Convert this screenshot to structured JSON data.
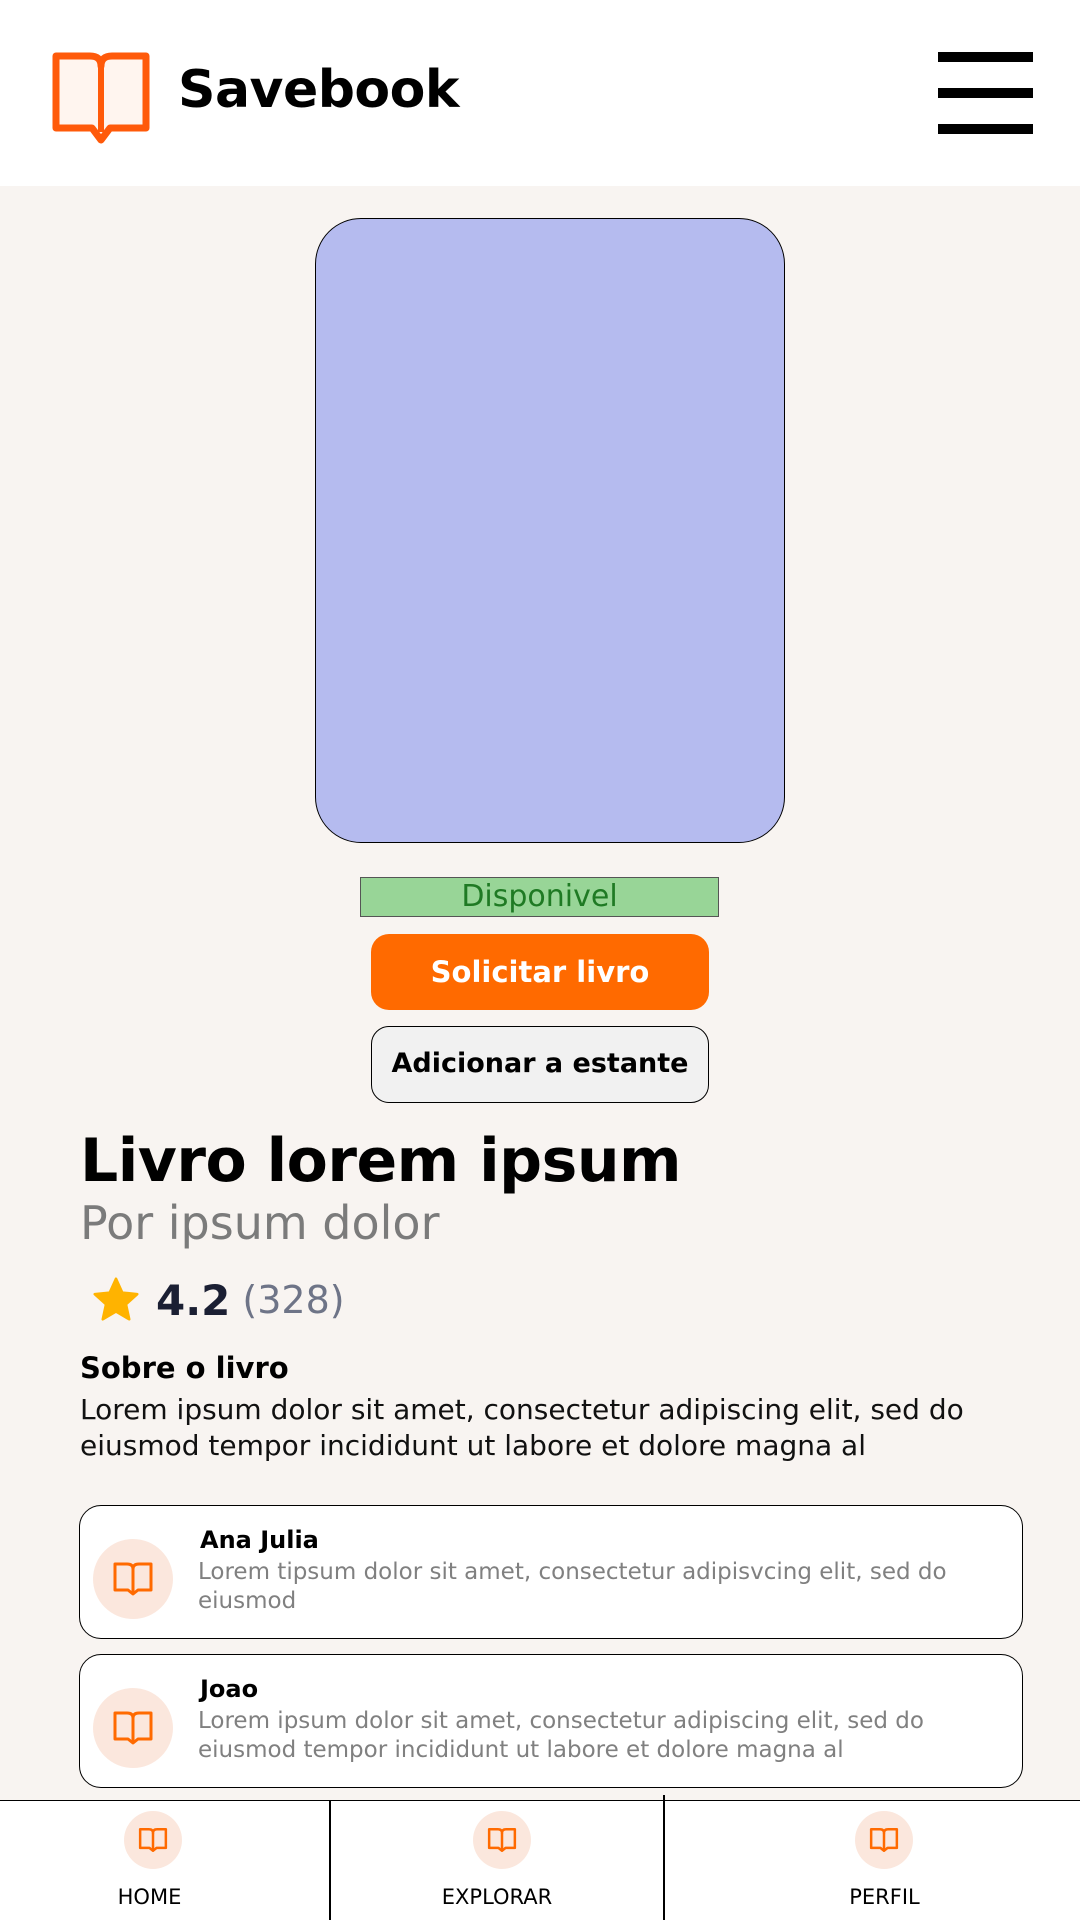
{
  "header": {
    "brand": "Savebook",
    "logo_icon": "open-book-icon",
    "menu_icon": "hamburger-menu-icon"
  },
  "book": {
    "status": "Disponivel",
    "request_label": "Solicitar livro",
    "shelf_label": "Adicionar a estante",
    "title": "Livro lorem ipsum",
    "author": "Por ipsum dolor",
    "rating": "4.2",
    "rating_count": "(328)",
    "about_heading": "Sobre o livro",
    "about_text": "Lorem ipsum dolor sit amet, consectetur adipiscing elit, sed do eiusmod tempor incididunt ut labore et dolore magna al"
  },
  "comments": [
    {
      "name": "Ana Julia",
      "text": "Lorem tipsum dolor sit amet, consectetur adipisvcing elit, sed do eiusmod"
    },
    {
      "name": "Joao",
      "text": "Lorem ipsum dolor sit amet, consectetur adipiscing elit, sed do eiusmod tempor incididunt ut labore et dolore magna al"
    }
  ],
  "nav": [
    {
      "label": "HOME",
      "icon": "book-icon"
    },
    {
      "label": "EXPLORAR",
      "icon": "book-icon"
    },
    {
      "label": "PERFIL",
      "icon": "book-icon"
    }
  ],
  "colors": {
    "accent": "#ff6a00",
    "cover": "#b5bbef",
    "status_bg": "#98d597",
    "status_text": "#1f7a24",
    "star": "#ffb300",
    "background": "#f8f4f1"
  }
}
